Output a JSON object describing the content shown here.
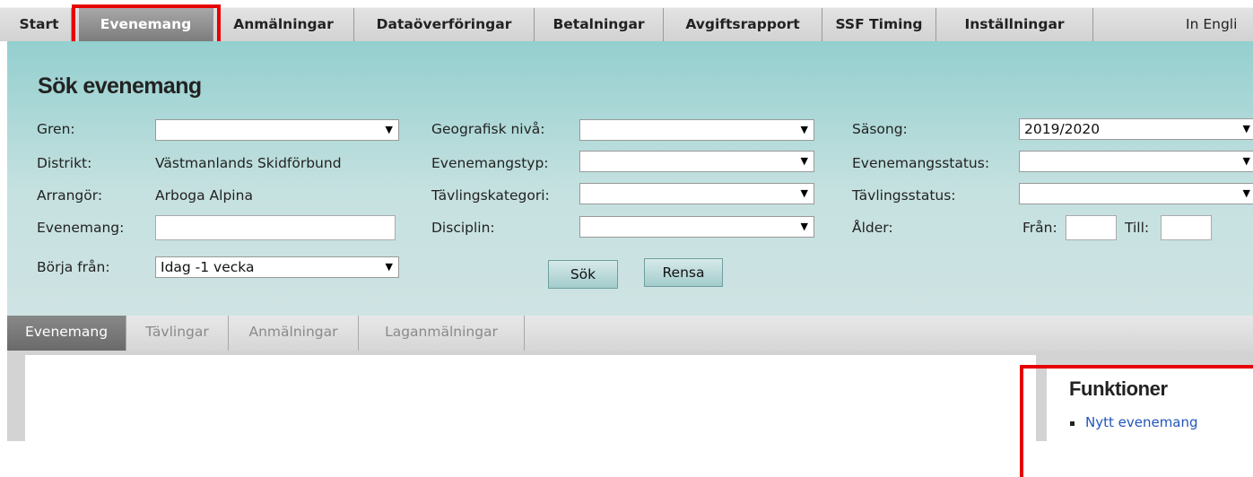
{
  "topnav": {
    "items": [
      {
        "label": "Start"
      },
      {
        "label": "Evenemang"
      },
      {
        "label": "Anmälningar"
      },
      {
        "label": "Dataöverföringar"
      },
      {
        "label": "Betalningar"
      },
      {
        "label": "Avgiftsrapport"
      },
      {
        "label": "SSF Timing"
      },
      {
        "label": "Inställningar"
      }
    ],
    "language": "In Engli"
  },
  "search": {
    "title": "Sök evenemang",
    "gren_label": "Gren:",
    "gren_value": "",
    "distrikt_label": "Distrikt:",
    "distrikt_value": "Västmanlands Skidförbund",
    "arrangor_label": "Arrangör:",
    "arrangor_value": "Arboga Alpina",
    "evenemang_label": "Evenemang:",
    "evenemang_value": "",
    "borja_label": "Börja från:",
    "borja_value": "Idag -1 vecka",
    "geo_label": "Geografisk nivå:",
    "geo_value": "",
    "typ_label": "Evenemangstyp:",
    "typ_value": "",
    "kategori_label": "Tävlingskategori:",
    "kategori_value": "",
    "disciplin_label": "Disciplin:",
    "disciplin_value": "",
    "sasong_label": "Säsong:",
    "sasong_value": "2019/2020",
    "evstatus_label": "Evenemangsstatus:",
    "evstatus_value": "",
    "tavstatus_label": "Tävlingsstatus:",
    "tavstatus_value": "",
    "alder_label": "Ålder:",
    "fran_label": "Från:",
    "till_label": "Till:",
    "search_button": "Sök",
    "clear_button": "Rensa"
  },
  "tabs": [
    {
      "label": "Evenemang"
    },
    {
      "label": "Tävlingar"
    },
    {
      "label": "Anmälningar"
    },
    {
      "label": "Laganmälningar"
    }
  ],
  "functions": {
    "title": "Funktioner",
    "links": [
      {
        "label": "Nytt evenemang"
      }
    ]
  },
  "colors": {
    "highlight": "#e60000",
    "panel": "#b3dada",
    "link": "#2255bb"
  }
}
